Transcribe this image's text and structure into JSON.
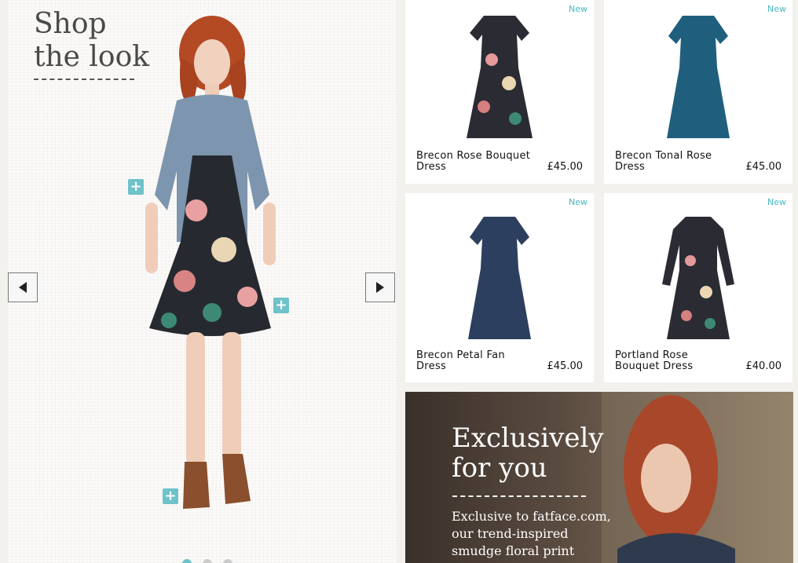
{
  "shop_the_look": {
    "title_line1": "Shop",
    "title_line2": "the look",
    "prev_icon": "triangle-left-icon",
    "next_icon": "triangle-right-icon",
    "hotspot_icon": "plus-icon",
    "hotspot_symbol": "+",
    "active_slide": 1,
    "slides": 3
  },
  "products": [
    {
      "name": "Brecon Rose Bouquet Dress",
      "price": "£45.00",
      "badge": "New"
    },
    {
      "name": "Brecon Tonal Rose Dress",
      "price": "£45.00",
      "badge": "New"
    },
    {
      "name": "Brecon Petal Fan Dress",
      "price": "£45.00",
      "badge": "New"
    },
    {
      "name": "Portland Rose Bouquet Dress",
      "price": "£40.00",
      "badge": "New"
    }
  ],
  "promo": {
    "headline_line1": "Exclusively",
    "headline_line2": "for you",
    "text_line1": "Exclusive to fatface.com,",
    "text_line2": "our trend-inspired",
    "text_line3": "smudge floral print"
  },
  "colors": {
    "accent": "#6ec2c9",
    "badge": "#4ab6bf"
  }
}
